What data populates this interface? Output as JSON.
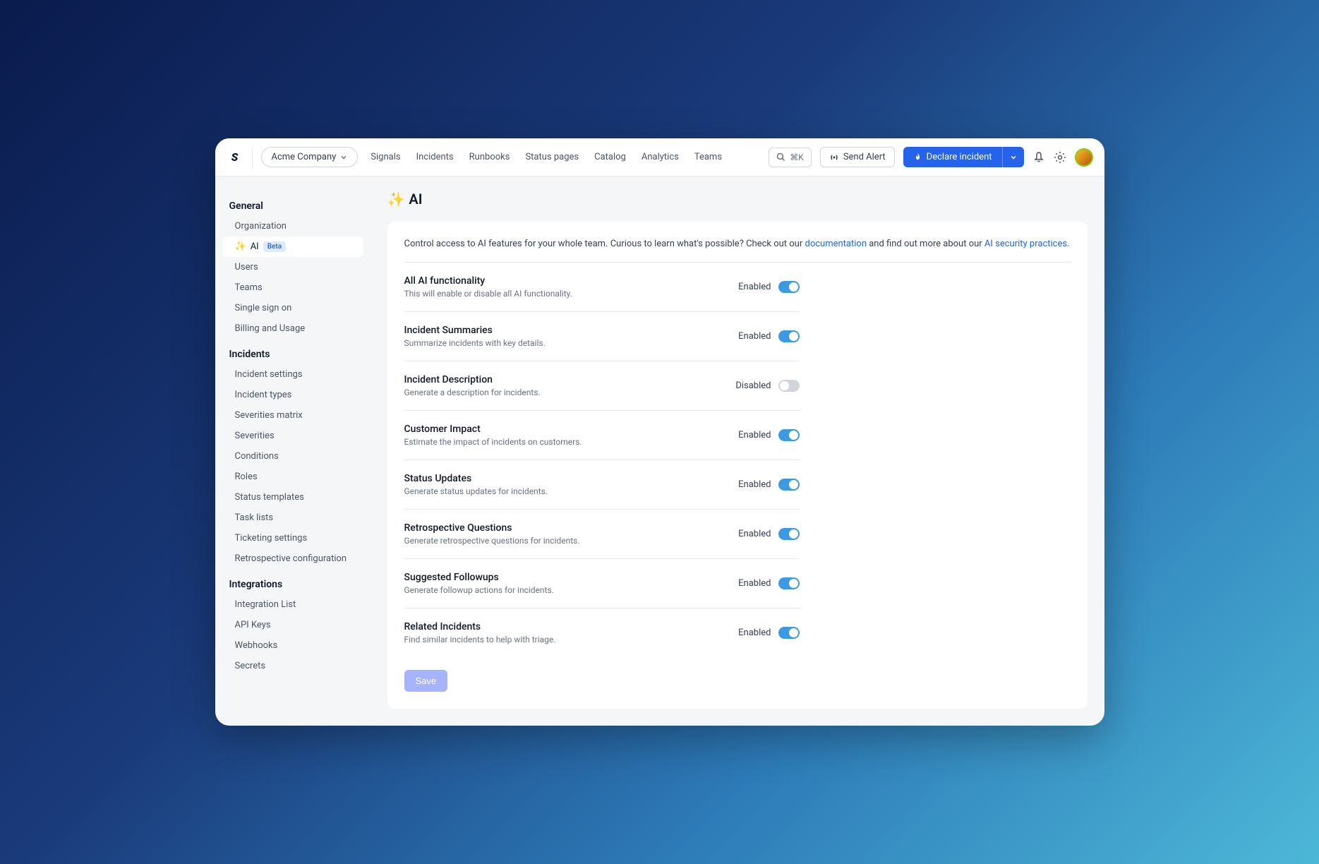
{
  "topbar": {
    "company": "Acme Company",
    "nav": [
      "Signals",
      "Incidents",
      "Runbooks",
      "Status pages",
      "Catalog",
      "Analytics",
      "Teams"
    ],
    "search_shortcut": "⌘K",
    "send_alert": "Send Alert",
    "declare": "Declare incident"
  },
  "sidebar": {
    "sections": [
      {
        "title": "General",
        "items": [
          {
            "label": "Organization"
          },
          {
            "label": "AI",
            "sparkle": true,
            "badge": "Beta",
            "active": true
          },
          {
            "label": "Users"
          },
          {
            "label": "Teams"
          },
          {
            "label": "Single sign on"
          },
          {
            "label": "Billing and Usage"
          }
        ]
      },
      {
        "title": "Incidents",
        "items": [
          {
            "label": "Incident settings"
          },
          {
            "label": "Incident types"
          },
          {
            "label": "Severities matrix"
          },
          {
            "label": "Severities"
          },
          {
            "label": "Conditions"
          },
          {
            "label": "Roles"
          },
          {
            "label": "Status templates"
          },
          {
            "label": "Task lists"
          },
          {
            "label": "Ticketing settings"
          },
          {
            "label": "Retrospective configuration"
          }
        ]
      },
      {
        "title": "Integrations",
        "items": [
          {
            "label": "Integration List"
          },
          {
            "label": "API Keys"
          },
          {
            "label": "Webhooks"
          },
          {
            "label": "Secrets"
          }
        ]
      }
    ]
  },
  "page": {
    "title": "AI",
    "intro_prefix": "Control access to AI features for your whole team. Curious to learn what's possible? Check out our ",
    "intro_link1": "documentation",
    "intro_mid": " and find out more about our ",
    "intro_link2": "AI security practices.",
    "save": "Save",
    "status_enabled": "Enabled",
    "status_disabled": "Disabled"
  },
  "settings": [
    {
      "title": "All AI functionality",
      "desc": "This will enable or disable all AI functionality.",
      "enabled": true
    },
    {
      "title": "Incident Summaries",
      "desc": "Summarize incidents with key details.",
      "enabled": true
    },
    {
      "title": "Incident Description",
      "desc": "Generate a description for incidents.",
      "enabled": false
    },
    {
      "title": "Customer Impact",
      "desc": "Estimate the impact of incidents on customers.",
      "enabled": true
    },
    {
      "title": "Status Updates",
      "desc": "Generate status updates for incidents.",
      "enabled": true
    },
    {
      "title": "Retrospective Questions",
      "desc": "Generate retrospective questions for incidents.",
      "enabled": true
    },
    {
      "title": "Suggested Followups",
      "desc": "Generate followup actions for incidents.",
      "enabled": true
    },
    {
      "title": "Related Incidents",
      "desc": "Find similar incidents to help with triage.",
      "enabled": true
    }
  ]
}
